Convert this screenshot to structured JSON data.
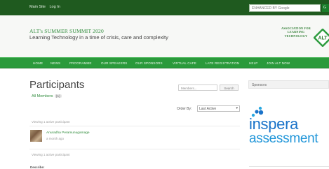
{
  "topbar": {
    "links": [
      "Main Site",
      "Log In"
    ],
    "search_placeholder": "ENHANCED BY Google",
    "go_label": "G"
  },
  "header": {
    "site_title": "ALT's SUMMER SUMMIT 2020",
    "tagline": "Learning Technology in a time of crisis, care and complexity",
    "logo_text": "ASSOCIATION FOR LEARNING TECHNOLOGY",
    "logo_mark": "ALT"
  },
  "nav": {
    "items": [
      "HOME",
      "NEWS",
      "PROGRAMME",
      "OUR SPEAKERS",
      "OUR SPONSORS",
      "VIRTUAL CAFE",
      "LATE REGISTRATION",
      "HELP",
      "JOIN ALT NOW"
    ]
  },
  "main": {
    "title": "Participants",
    "members_tab": "All Members",
    "members_count": "(A)",
    "search_placeholder": "Members...",
    "search_button": "Search",
    "order_by_label": "Order By:",
    "order_by_value": "Last Active",
    "viewing_text": "Viewing 1 active participant",
    "member": {
      "name": "Anuradha Peramunugamage",
      "active": "a month ago"
    },
    "describe_label": "Describe:"
  },
  "sidebar": {
    "sponsors_title": "Sponsors",
    "sponsor_name_1": "inspera",
    "sponsor_name_2": "assessment"
  },
  "colors": {
    "topbar": "#1f5a1f",
    "nav": "#2a9a3b",
    "accent": "#2e8b3a",
    "sponsor_blue": "#1a73c9"
  }
}
